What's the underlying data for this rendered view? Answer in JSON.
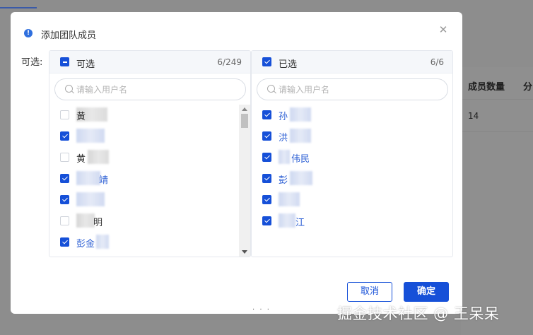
{
  "background": {
    "col_header_1": "成员数量",
    "col_header_2": "分",
    "cell_value": "14"
  },
  "modal": {
    "title": "添加团队成员",
    "field_label": "可选:",
    "left": {
      "header": "可选",
      "count": "6/249",
      "search_placeholder": "请输入用户名",
      "items": [
        {
          "name": "黄",
          "checked": false
        },
        {
          "name": "",
          "checked": true
        },
        {
          "name": "黄",
          "checked": false
        },
        {
          "name": "靖",
          "checked": true
        },
        {
          "name": "",
          "checked": true
        },
        {
          "name": "明",
          "checked": false
        },
        {
          "name": "彭金",
          "checked": true
        }
      ]
    },
    "right": {
      "header": "已选",
      "count": "6/6",
      "search_placeholder": "请输入用户名",
      "items": [
        {
          "name": "孙",
          "checked": true
        },
        {
          "name": "洪",
          "checked": true
        },
        {
          "name": "伟民",
          "checked": true
        },
        {
          "name": "彭",
          "checked": true
        },
        {
          "name": "",
          "checked": true
        },
        {
          "name": "江",
          "checked": true
        }
      ]
    },
    "cancel_label": "取消",
    "ok_label": "确定"
  },
  "watermark": "掘金技术社区 @ 王呆呆",
  "colors": {
    "accent": "#1650d8",
    "selected_text": "#2c5fd4"
  }
}
